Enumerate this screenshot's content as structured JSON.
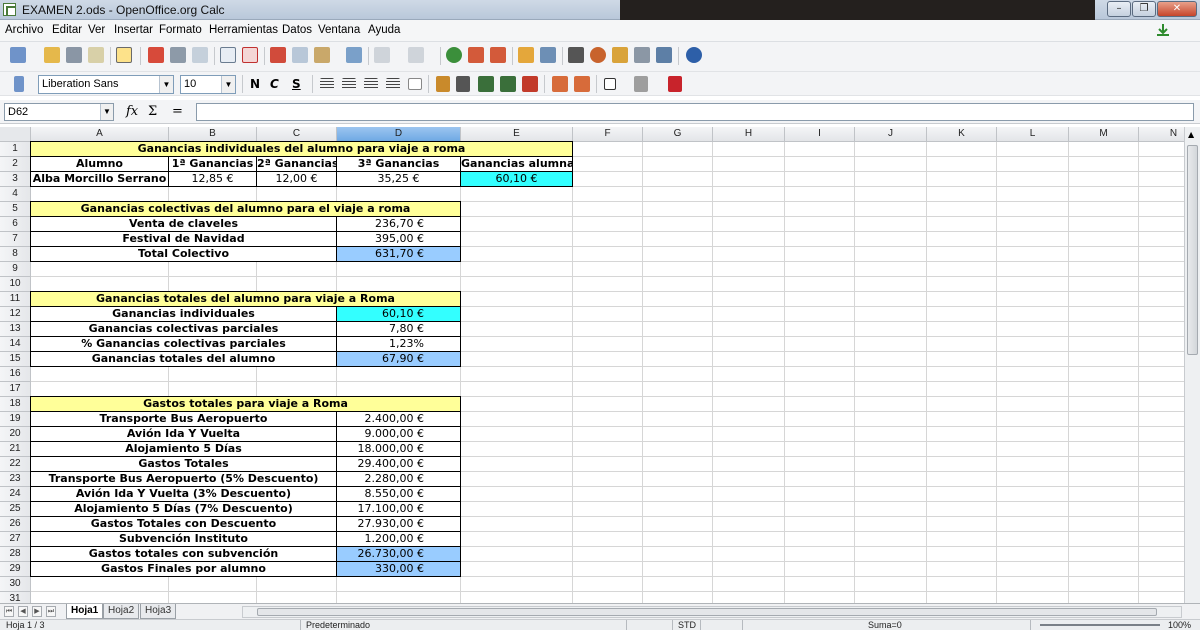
{
  "window": {
    "title": "EXAMEN 2.ods - OpenOffice.org Calc",
    "minimize_glyph": "–",
    "restore_glyph": "❐",
    "close_glyph": "✕"
  },
  "menu": [
    "Archivo",
    "Editar",
    "Ver",
    "Insertar",
    "Formato",
    "Herramientas",
    "Datos",
    "Ventana",
    "Ayuda"
  ],
  "format_bar": {
    "font_name": "Liberation Sans",
    "font_size": "10",
    "bold": "N",
    "italic": "C",
    "underline": "S"
  },
  "formula_bar": {
    "cell_ref": "D62",
    "formula": ""
  },
  "columns": [
    "A",
    "B",
    "C",
    "D",
    "E",
    "F",
    "G",
    "H",
    "I",
    "J",
    "K",
    "L",
    "M",
    "N"
  ],
  "rows": [
    "1",
    "2",
    "3",
    "4",
    "5",
    "6",
    "7",
    "8",
    "9",
    "10",
    "11",
    "12",
    "13",
    "14",
    "15",
    "16",
    "17",
    "18",
    "19",
    "20",
    "21",
    "22",
    "23",
    "24",
    "25",
    "26",
    "27",
    "28",
    "29",
    "30",
    "31"
  ],
  "sheet": {
    "t1": {
      "title": "Ganancias individuales del alumno para viaje a roma",
      "headers": [
        "Alumno",
        "1ª Ganancias",
        "2ª Ganancias",
        "3ª Ganancias",
        "Ganancias alumna"
      ],
      "values": [
        "Alba Morcillo Serrano",
        "12,85 €",
        "12,00 €",
        "35,25 €",
        "60,10 €"
      ]
    },
    "t2": {
      "title": "Ganancias colectivas del alumno para el viaje a roma",
      "rows": [
        {
          "label": "Venta de claveles",
          "value": "236,70 €"
        },
        {
          "label": "Festival de Navidad",
          "value": "395,00 €"
        },
        {
          "label": "Total Colectivo",
          "value": "631,70 €"
        }
      ]
    },
    "t3": {
      "title": "Ganancias totales del alumno para viaje a Roma",
      "rows": [
        {
          "label": "Ganancias individuales",
          "value": "60,10 €"
        },
        {
          "label": "Ganancias colectivas parciales",
          "value": "7,80 €"
        },
        {
          "label": "% Ganancias colectivas parciales",
          "value": "1,23%"
        },
        {
          "label": "Ganancias totales del alumno",
          "value": "67,90 €"
        }
      ]
    },
    "t4": {
      "title": "Gastos totales para viaje a Roma",
      "rows": [
        {
          "label": "Transporte Bus Aeropuerto",
          "value": "2.400,00 €"
        },
        {
          "label": "Avión Ida Y Vuelta",
          "value": "9.000,00 €"
        },
        {
          "label": "Alojamiento 5 Días",
          "value": "18.000,00 €"
        },
        {
          "label": "Gastos Totales",
          "value": "29.400,00 €"
        },
        {
          "label": "Transporte Bus Aeropuerto (5% Descuento)",
          "value": "2.280,00 €"
        },
        {
          "label": "Avión Ida Y Vuelta (3% Descuento)",
          "value": "8.550,00 €"
        },
        {
          "label": "Alojamiento 5 Días (7% Descuento)",
          "value": "17.100,00 €"
        },
        {
          "label": "Gastos Totales con Descuento",
          "value": "27.930,00 €"
        },
        {
          "label": "Subvención Instituto",
          "value": "1.200,00 €"
        },
        {
          "label": "Gastos totales con subvención",
          "value": "26.730,00 €"
        },
        {
          "label": "Gastos Finales por alumno",
          "value": "330,00 €"
        }
      ]
    }
  },
  "tabs": [
    "Hoja1",
    "Hoja2",
    "Hoja3"
  ],
  "status": {
    "sheet": "Hoja 1 / 3",
    "style": "Predeterminado",
    "mode": "STD",
    "sum": "Suma=0",
    "zoom": "100%"
  },
  "colors": {
    "header_fill": "#ffff99",
    "highlight_cyan": "#33ffff",
    "highlight_blue": "#99ccff",
    "selected_column": "#6fa9e4"
  }
}
